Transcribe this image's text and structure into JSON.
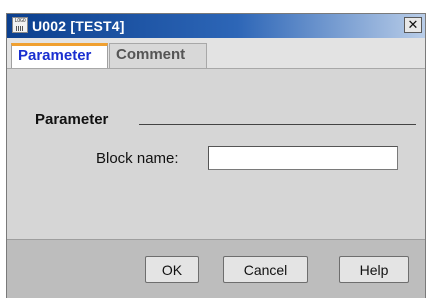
{
  "window": {
    "title": "U002 [TEST4]",
    "icon_text": "LOGO",
    "icon": "logo-app-icon",
    "close_glyph": "✕",
    "close_icon": "close-icon"
  },
  "tabs": [
    {
      "label": "Parameter",
      "active": true
    },
    {
      "label": "Comment",
      "active": false
    }
  ],
  "section": {
    "title": "Parameter"
  },
  "fields": {
    "block_name_label": "Block name:",
    "block_name_value": ""
  },
  "buttons": {
    "ok": "OK",
    "cancel": "Cancel",
    "help": "Help"
  },
  "colors": {
    "title_bar_start": "#0b3f8e",
    "active_tab_text": "#1a2fd0",
    "active_tab_accent": "#f0a030"
  }
}
